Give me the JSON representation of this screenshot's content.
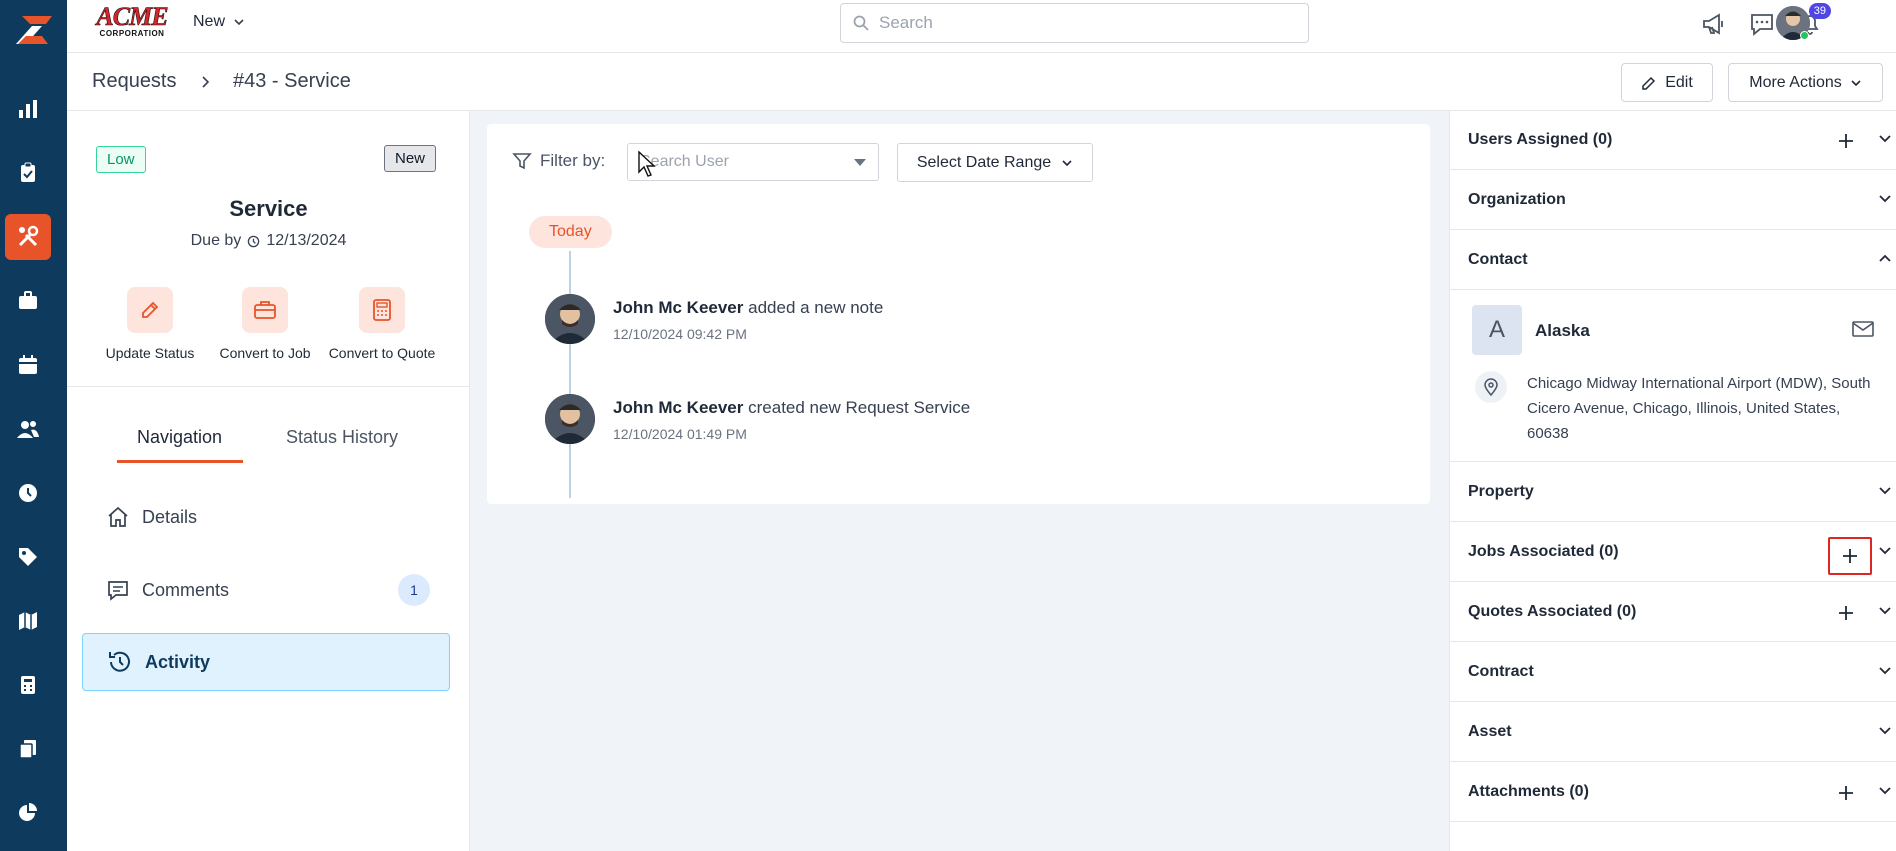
{
  "topbar": {
    "logo_main": "ACME",
    "logo_sub": "CORPORATION",
    "new_label": "New",
    "search_placeholder": "Search",
    "notifications_count": "39"
  },
  "breadcrumb": {
    "parent": "Requests",
    "current": "#43 - Service"
  },
  "header_actions": {
    "edit_label": "Edit",
    "more_label": "More Actions"
  },
  "request": {
    "priority": "Low",
    "status": "New",
    "title": "Service",
    "due_prefix": "Due by",
    "due_date": "12/13/2024"
  },
  "quick_actions": [
    {
      "label": "Update Status",
      "icon": "pencil-icon"
    },
    {
      "label": "Convert to Job",
      "icon": "briefcase-icon"
    },
    {
      "label": "Convert to Quote",
      "icon": "calculator-icon"
    }
  ],
  "tabs": {
    "navigation": "Navigation",
    "status_history": "Status History"
  },
  "nav_items": [
    {
      "label": "Details",
      "icon": "home-icon"
    },
    {
      "label": "Comments",
      "icon": "comment-icon",
      "count": "1"
    },
    {
      "label": "Activity",
      "icon": "history-icon"
    }
  ],
  "filter": {
    "label": "Filter by:",
    "user_placeholder": "Search User",
    "date_label": "Select Date Range"
  },
  "timeline": {
    "day_label": "Today",
    "entries": [
      {
        "user": "John Mc Keever",
        "action": "added a new note",
        "time": "12/10/2024 09:42 PM"
      },
      {
        "user": "John Mc Keever",
        "action": "created new Request Service",
        "time": "12/10/2024 01:49 PM"
      }
    ]
  },
  "right_sections": {
    "users": "Users Assigned (0)",
    "organization": "Organization",
    "contact": "Contact",
    "property": "Property",
    "jobs": "Jobs Associated (0)",
    "quotes": "Quotes Associated (0)",
    "contract": "Contract",
    "asset": "Asset",
    "attachments": "Attachments (0)"
  },
  "contact": {
    "initial": "A",
    "name": "Alaska",
    "address": "Chicago Midway International Airport (MDW), South Cicero Avenue, Chicago, Illinois, United States, 60638"
  },
  "colors": {
    "rail": "#0e3a5e",
    "accent": "#e8542a",
    "highlight": "#dc2626"
  }
}
